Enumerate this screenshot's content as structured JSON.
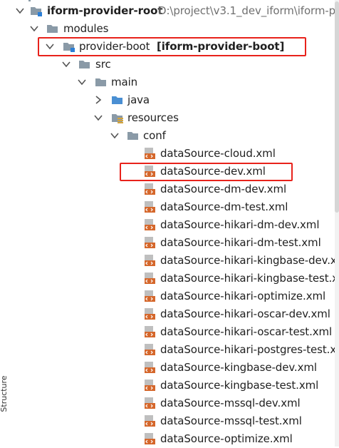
{
  "project": {
    "root_name": "iform-provider-root",
    "root_path": "D:\\project\\v3.1_dev_iform\\iform-p"
  },
  "tree": {
    "modules": "modules",
    "provider_boot": "provider-boot",
    "provider_boot_artifact": "[iform-provider-boot]",
    "src": "src",
    "main": "main",
    "java": "java",
    "resources": "resources",
    "conf": "conf",
    "files": [
      "dataSource-cloud.xml",
      "dataSource-dev.xml",
      "dataSource-dm-dev.xml",
      "dataSource-dm-test.xml",
      "dataSource-hikari-dm-dev.xml",
      "dataSource-hikari-dm-test.xml",
      "dataSource-hikari-kingbase-dev.xml",
      "dataSource-hikari-kingbase-test.xml",
      "dataSource-hikari-optimize.xml",
      "dataSource-hikari-oscar-dev.xml",
      "dataSource-hikari-oscar-test.xml",
      "dataSource-hikari-postgres-test.xml",
      "dataSource-kingbase-dev.xml",
      "dataSource-kingbase-test.xml",
      "dataSource-mssql-dev.xml",
      "dataSource-mssql-test.xml",
      "dataSource-optimize.xml"
    ]
  },
  "side_panel": {
    "structure_label": "Structure"
  },
  "colors": {
    "highlight": "#e8221b",
    "folder": "#8a9aa7",
    "java_folder": "#4a8fd3",
    "xml_icon": "#d5672b"
  },
  "icons": {
    "expand": "chevron-down-icon",
    "folder": "folder-icon",
    "module": "module-folder-icon",
    "source_folder": "java-source-folder-icon",
    "resource_folder": "resources-folder-icon",
    "xml_file": "xml-file-icon"
  }
}
